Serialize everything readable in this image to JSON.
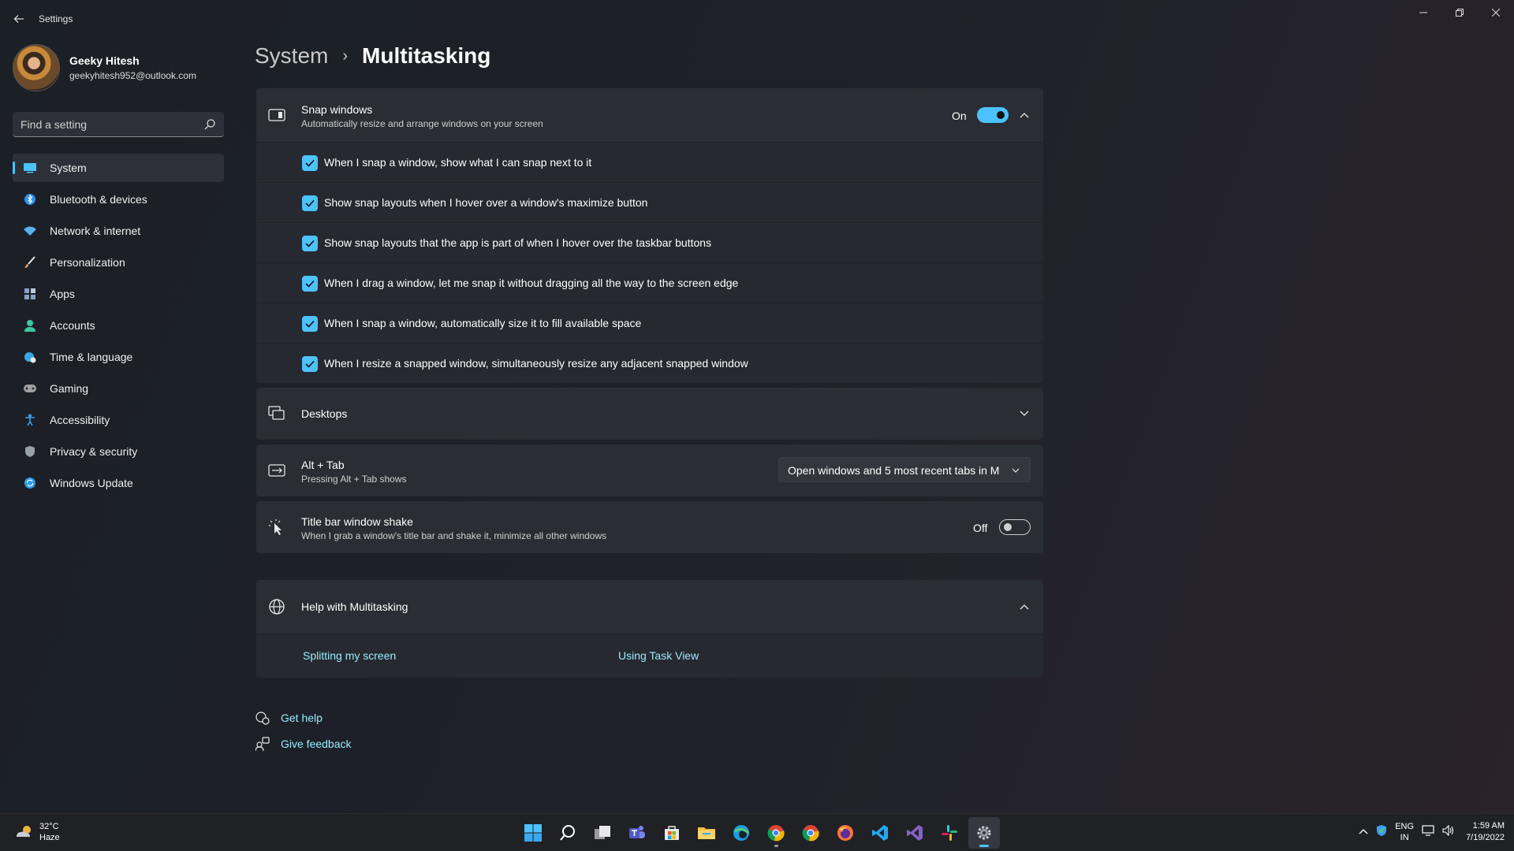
{
  "window": {
    "title": "Settings"
  },
  "profile": {
    "name": "Geeky Hitesh",
    "email": "geekyhitesh952@outlook.com"
  },
  "search": {
    "placeholder": "Find a setting"
  },
  "nav": {
    "items": [
      {
        "label": "System",
        "icon": "system-icon",
        "color": "#4cc2ff"
      },
      {
        "label": "Bluetooth & devices",
        "icon": "bluetooth-icon",
        "color": "#2f8ff0"
      },
      {
        "label": "Network & internet",
        "icon": "wifi-icon",
        "color": "#5ab0f0"
      },
      {
        "label": "Personalization",
        "icon": "brush-icon",
        "color": "#e8a060"
      },
      {
        "label": "Apps",
        "icon": "apps-icon",
        "color": "#8aa0c8"
      },
      {
        "label": "Accounts",
        "icon": "person-icon",
        "color": "#3cc8a0"
      },
      {
        "label": "Time & language",
        "icon": "globe-clock-icon",
        "color": "#3aa8e8"
      },
      {
        "label": "Gaming",
        "icon": "gamepad-icon",
        "color": "#a0a0a0"
      },
      {
        "label": "Accessibility",
        "icon": "accessibility-icon",
        "color": "#3aa0f0"
      },
      {
        "label": "Privacy & security",
        "icon": "shield-icon",
        "color": "#9aa0a8"
      },
      {
        "label": "Windows Update",
        "icon": "update-icon",
        "color": "#2a9ae8"
      }
    ]
  },
  "breadcrumb": {
    "parent": "System",
    "current": "Multitasking"
  },
  "snap": {
    "title": "Snap windows",
    "subtitle": "Automatically resize and arrange windows on your screen",
    "state": "On",
    "options": [
      "When I snap a window, show what I can snap next to it",
      "Show snap layouts when I hover over a window's maximize button",
      "Show snap layouts that the app is part of when I hover over the taskbar buttons",
      "When I drag a window, let me snap it without dragging all the way to the screen edge",
      "When I snap a window, automatically size it to fill available space",
      "When I resize a snapped window, simultaneously resize any adjacent snapped window"
    ]
  },
  "desktops": {
    "title": "Desktops"
  },
  "alttab": {
    "title": "Alt + Tab",
    "subtitle": "Pressing Alt + Tab shows",
    "selected": "Open windows and 5 most recent tabs in M"
  },
  "shake": {
    "title": "Title bar window shake",
    "subtitle": "When I grab a window's title bar and shake it, minimize all other windows",
    "state": "Off"
  },
  "help": {
    "title": "Help with Multitasking",
    "links": [
      "Splitting my screen",
      "Using Task View"
    ]
  },
  "footer": {
    "get_help": "Get help",
    "give_feedback": "Give feedback"
  },
  "taskbar": {
    "weather_temp": "32°C",
    "weather_desc": "Haze",
    "lang": "ENG",
    "region": "IN",
    "time": "1:59 AM",
    "date": "7/19/2022",
    "accent": "#4cc2ff"
  }
}
